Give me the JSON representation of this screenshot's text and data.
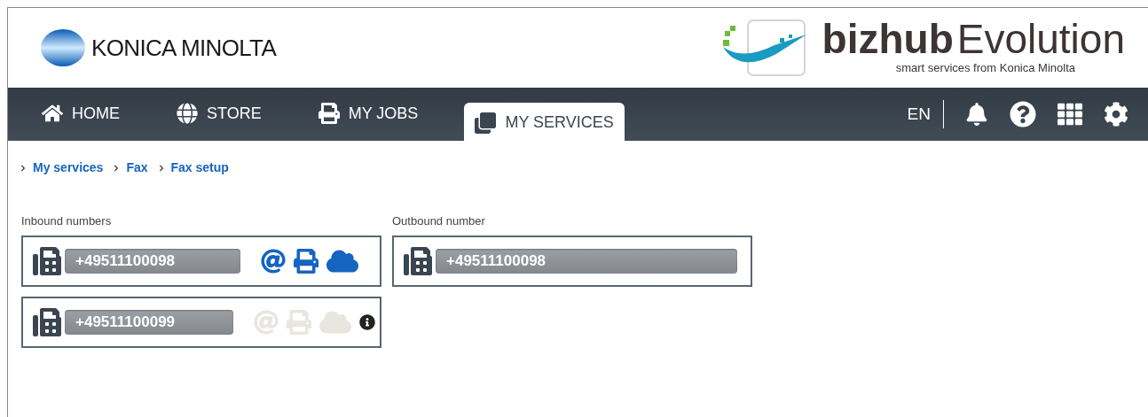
{
  "brand": {
    "company": "KONICA MINOLTA",
    "product_bold": "bizhub",
    "product_light": "Evolution",
    "tagline": "smart services from Konica Minolta"
  },
  "nav": {
    "tabs": [
      {
        "label": "HOME",
        "kind": "home",
        "selected": false
      },
      {
        "label": "STORE",
        "kind": "store",
        "selected": false
      },
      {
        "label": "MY JOBS",
        "kind": "jobs",
        "selected": false
      },
      {
        "label": "MY SERVICES",
        "kind": "services",
        "selected": true
      }
    ],
    "language": "EN"
  },
  "breadcrumb": [
    "My services",
    "Fax",
    "Fax setup"
  ],
  "inbound": {
    "title": "Inbound numbers",
    "numbers": [
      {
        "number": "+49511100098",
        "enabled": true,
        "info": false
      },
      {
        "number": "+49511100099",
        "enabled": false,
        "info": true
      }
    ]
  },
  "outbound": {
    "title": "Outbound number",
    "number": "+49511100098"
  }
}
